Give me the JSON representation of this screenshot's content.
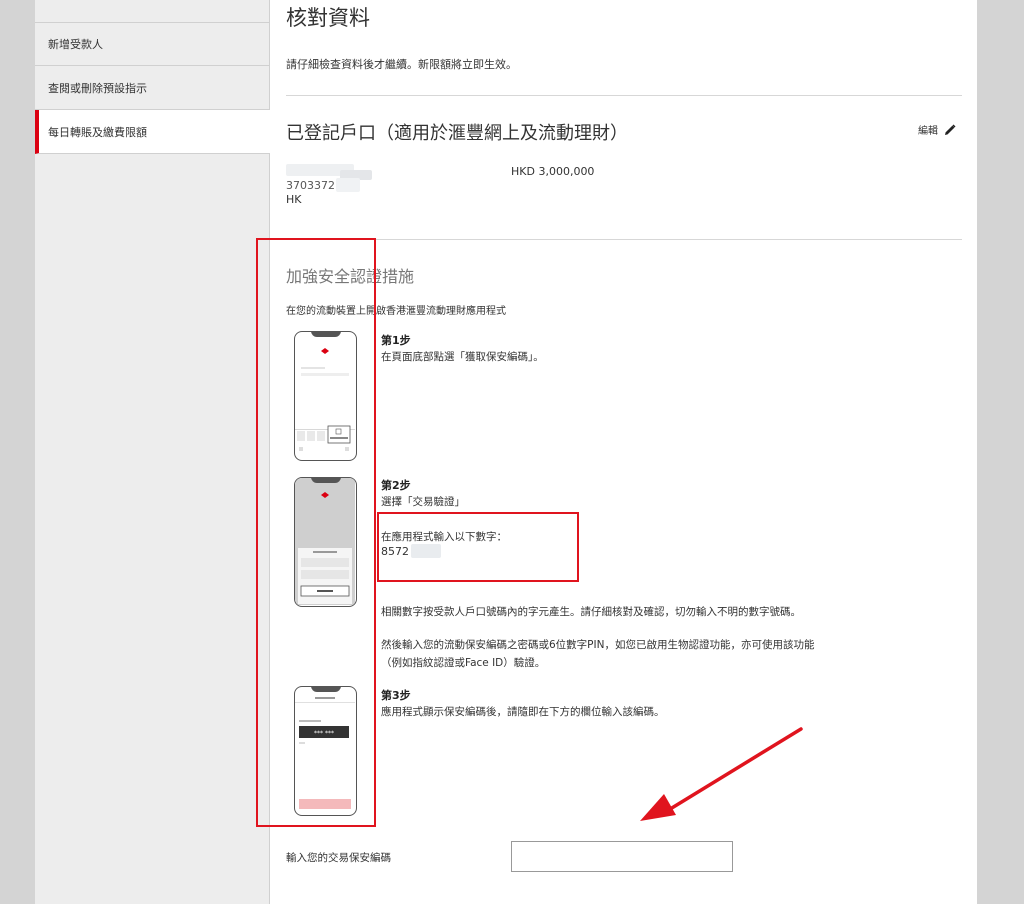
{
  "sidebar": {
    "items": [
      {
        "label": "新增受款人"
      },
      {
        "label": "查閱或刪除預設指示"
      },
      {
        "label": "每日轉賬及繳費限額"
      }
    ]
  },
  "main": {
    "title": "核對資料",
    "intro": "請仔細檢查資料後才繼續。新限額將立即生效。",
    "registered": {
      "title": "已登記戶口（適用於滙豐網上及流動理財）",
      "edit_label": "編輯",
      "account_partial": "3703372",
      "account_region": "HK",
      "amount": "HKD  3,000,000"
    },
    "security": {
      "title": "加強安全認證措施",
      "subtitle": "在您的流動裝置上開啟香港滙豐流動理財應用程式",
      "step1_heading": "第1步",
      "step1_text": "在頁面底部點選「獲取保安編碼」。",
      "step2_heading": "第2步",
      "step2_text": "選擇「交易驗證」",
      "step2_enter": "在應用程式輸入以下數字：",
      "step2_number": "8572",
      "note1": "相關數字按受款人戶口號碼內的字元產生。請仔細核對及確認，切勿輸入不明的數字號碼。",
      "note2_line1": "然後輸入您的流動保安編碼之密碼或6位數字PIN，如您已啟用生物認證功能，亦可使用該功能",
      "note2_line2": "（例如指紋認證或Face ID）驗證。",
      "step3_heading": "第3步",
      "step3_text": "應用程式顯示保安編碼後，請隨即在下方的欄位輸入該編碼。",
      "phone3_code": "*** ***",
      "code_label": "輸入您的交易保安編碼"
    }
  },
  "colors": {
    "accent": "#db0011",
    "annotation": "#e0141e",
    "sidebar_bg": "#ededed"
  }
}
